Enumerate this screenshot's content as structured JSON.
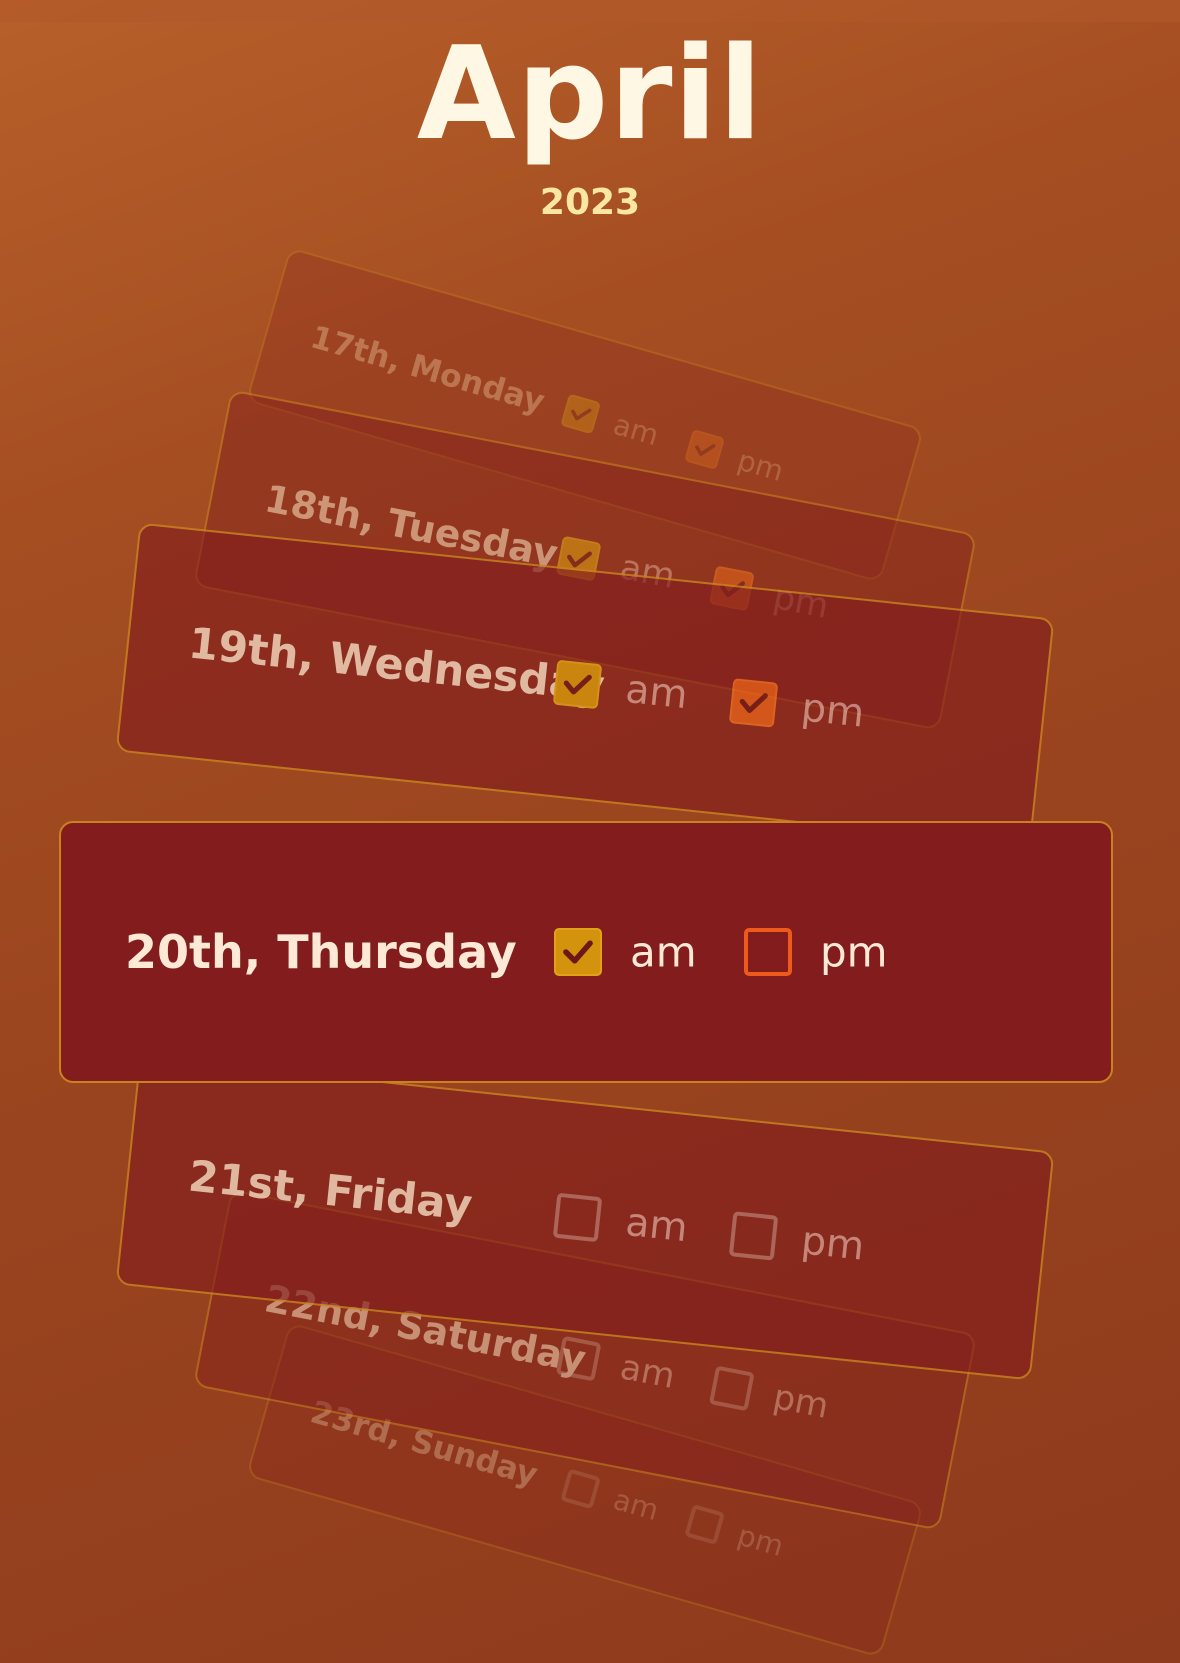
{
  "header": {
    "month": "April",
    "year": "2023"
  },
  "days": [
    {
      "label": "17th, Monday",
      "am": true,
      "pm": true
    },
    {
      "label": "18th, Tuesday",
      "am": true,
      "pm": true
    },
    {
      "label": "19th, Wednesday",
      "am": true,
      "pm": true
    },
    {
      "label": "20th, Thursday",
      "am": true,
      "pm": false
    },
    {
      "label": "21st, Friday",
      "am": false,
      "pm": false
    },
    {
      "label": "22nd, Saturday",
      "am": false,
      "pm": false
    },
    {
      "label": "23rd, Sunday",
      "am": false,
      "pm": false
    }
  ],
  "labels": {
    "am": "am",
    "pm": "pm"
  },
  "colors": {
    "am_check": "#d4930c",
    "pm_check": "#e05a1a",
    "card": "#821c1d",
    "border": "#c9821e"
  }
}
